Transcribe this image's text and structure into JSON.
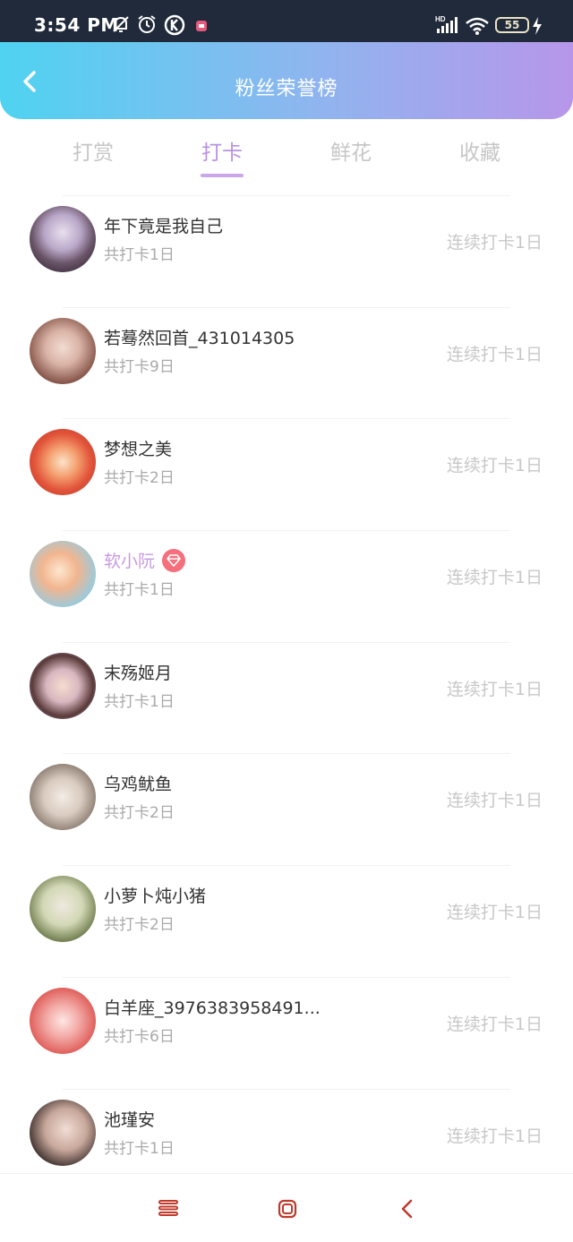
{
  "status_bar": {
    "time": "3:54 PM",
    "battery": "55",
    "icons": [
      "mute-icon",
      "alarm-icon",
      "k-icon",
      "app-icon",
      "signal-icon",
      "wifi-icon",
      "battery-icon",
      "charging-icon"
    ]
  },
  "header": {
    "title": "粉丝荣誉榜",
    "back_icon": "chevron-left-icon"
  },
  "tabs": [
    {
      "label": "打赏",
      "active": false
    },
    {
      "label": "打卡",
      "active": true
    },
    {
      "label": "鲜花",
      "active": false
    },
    {
      "label": "收藏",
      "active": false
    }
  ],
  "colors": {
    "accent": "#b893e0",
    "header_start": "#4fd3f0",
    "header_end": "#b796ea",
    "vip_name": "#c89be1",
    "badge": "#f56f7c"
  },
  "fans": [
    {
      "name": "年下竟是我自己",
      "total": "共打卡1日",
      "streak": "连续打卡1日",
      "vip": false
    },
    {
      "name": "若蓦然回首_431014305",
      "total": "共打卡9日",
      "streak": "连续打卡1日",
      "vip": false
    },
    {
      "name": "梦想之美",
      "total": "共打卡2日",
      "streak": "连续打卡1日",
      "vip": false
    },
    {
      "name": "软小阮",
      "total": "共打卡1日",
      "streak": "连续打卡1日",
      "vip": true
    },
    {
      "name": "末殇姬月",
      "total": "共打卡1日",
      "streak": "连续打卡1日",
      "vip": false
    },
    {
      "name": "乌鸡鱿鱼",
      "total": "共打卡2日",
      "streak": "连续打卡1日",
      "vip": false
    },
    {
      "name": "小萝卜炖小猪",
      "total": "共打卡2日",
      "streak": "连续打卡1日",
      "vip": false
    },
    {
      "name": "白羊座_3976383958491...",
      "total": "共打卡6日",
      "streak": "连续打卡1日",
      "vip": false
    },
    {
      "name": "池瑾安",
      "total": "共打卡1日",
      "streak": "连续打卡1日",
      "vip": false
    }
  ],
  "nav_bar": {
    "icons": [
      "menu-icon",
      "home-icon",
      "back-icon"
    ]
  }
}
